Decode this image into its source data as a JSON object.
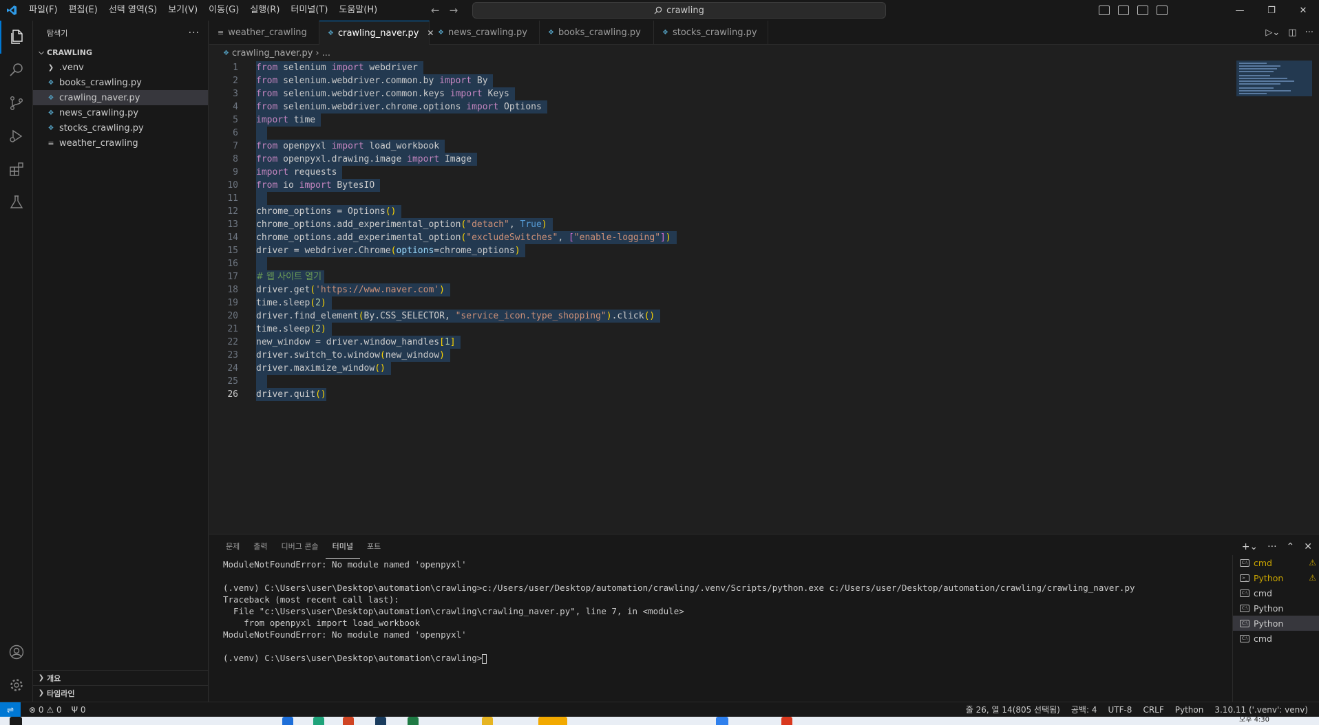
{
  "titlebar": {
    "menus": [
      "파일(F)",
      "편집(E)",
      "선택 영역(S)",
      "보기(V)",
      "이동(G)",
      "실행(R)",
      "터미널(T)",
      "도움말(H)"
    ],
    "search": "crawling"
  },
  "sidebar": {
    "title": "탐색기",
    "folder": "CRAWLING",
    "items": [
      ".venv",
      "books_crawling.py",
      "crawling_naver.py",
      "news_crawling.py",
      "stocks_crawling.py",
      "weather_crawling"
    ],
    "outline": "개요",
    "timeline": "타임라인"
  },
  "tabs": [
    "weather_crawling",
    "crawling_naver.py",
    "news_crawling.py",
    "books_crawling.py",
    "stocks_crawling.py"
  ],
  "breadcrumb": {
    "file": "crawling_naver.py",
    "rest": "..."
  },
  "editor": {
    "line_numbers": [
      "1",
      "2",
      "3",
      "4",
      "5",
      "6",
      "7",
      "8",
      "9",
      "10",
      "11",
      "12",
      "13",
      "14",
      "15",
      "16",
      "17",
      "18",
      "19",
      "20",
      "21",
      "22",
      "23",
      "24",
      "25",
      "26"
    ]
  },
  "panel": {
    "tabs": [
      "문제",
      "출력",
      "디버그 콘솔",
      "터미널",
      "포트"
    ],
    "terminal_lines": [
      "ModuleNotFoundError: No module named 'openpyxl'",
      "",
      "(.venv) C:\\Users\\user\\Desktop\\automation\\crawling>c:/Users/user/Desktop/automation/crawling/.venv/Scripts/python.exe c:/Users/user/Desktop/automation/crawling/crawling_naver.py",
      "Traceback (most recent call last):",
      "  File \"c:\\Users\\user\\Desktop\\automation\\crawling\\crawling_naver.py\", line 7, in <module>",
      "    from openpyxl import load_workbook",
      "ModuleNotFoundError: No module named 'openpyxl'",
      "",
      "(.venv) C:\\Users\\user\\Desktop\\automation\\crawling>"
    ],
    "terminals": [
      "cmd",
      "Python",
      "cmd",
      "Python",
      "Python",
      "cmd"
    ]
  },
  "statusbar": {
    "errors": "0",
    "warnings": "0",
    "ports": "0",
    "position": "줄 26, 열 14(805 선택됨)",
    "spaces": "공백: 4",
    "encoding": "UTF-8",
    "eol": "CRLF",
    "language": "Python",
    "interpreter": "3.10.11 ('.venv': venv)"
  },
  "taskbar": {
    "time": "오후 4:30"
  },
  "colors": {
    "accent": "#0078d4",
    "editor_bg": "#1f1f1f",
    "chrome_bg": "#181818",
    "selection": "#264f78"
  },
  "icons": [
    "vscode-logo-icon",
    "explorer-icon",
    "search-icon",
    "source-control-icon",
    "run-debug-icon",
    "extensions-icon",
    "testing-icon",
    "account-icon",
    "settings-gear-icon",
    "python-file-icon",
    "file-icon",
    "folder-chevron-icon",
    "run-icon",
    "split-editor-icon",
    "more-actions-icon",
    "warning-icon",
    "terminal-icon"
  ]
}
